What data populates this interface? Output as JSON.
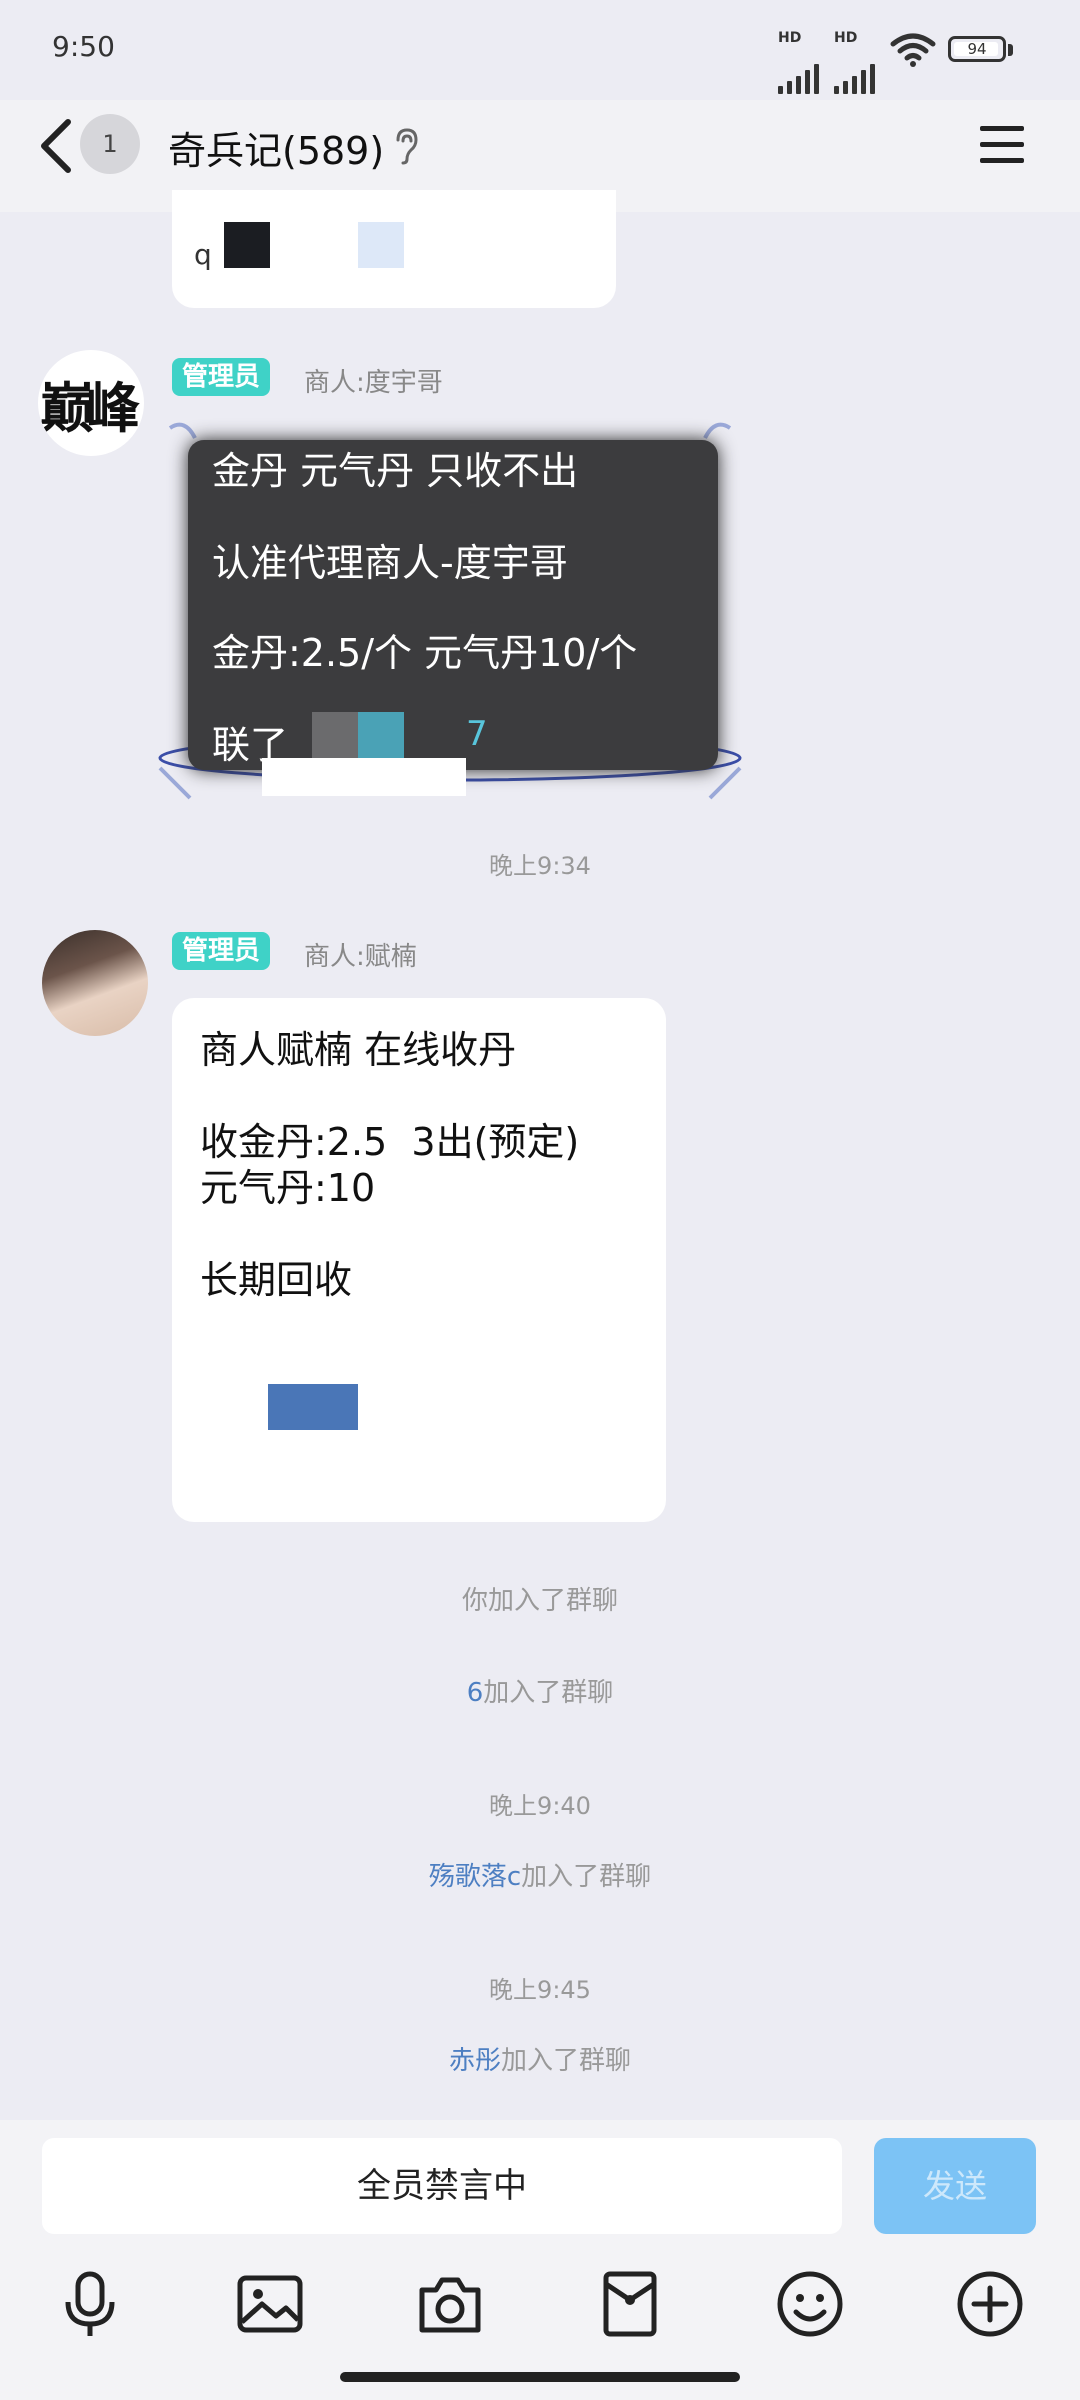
{
  "status_bar": {
    "time": "9:50",
    "signal_labels": [
      "HD",
      "HD"
    ],
    "battery": "94"
  },
  "header": {
    "unread_count": "1",
    "title": "奇兵记(589)"
  },
  "messages": {
    "partial_text": "q",
    "msg1": {
      "admin_tag": "管理员",
      "sender": "商人:度宇哥",
      "avatar_text": "巅峰",
      "lines": [
        "金丹 元气丹 只收不出",
        "认准代理商人-度宇哥",
        "金丹:2.5/个 元气丹10/个",
        "联了",
        "7"
      ]
    },
    "time1": "晚上9:34",
    "msg2": {
      "admin_tag": "管理员",
      "sender": "商人:赋楠",
      "lines": [
        "商人赋楠 在线收丹",
        "收金丹:2.5  3出(预定)",
        "元气丹:10",
        "长期回收"
      ]
    },
    "join1": "你加入了群聊",
    "join2": {
      "nick": "6",
      "text": "加入了群聊"
    },
    "time2": "晚上9:40",
    "join3": {
      "nick": "殇歌落c",
      "text": "加入了群聊"
    },
    "time3": "晚上9:45",
    "join4": {
      "nick": "赤彤",
      "text": "加入了群聊"
    }
  },
  "input": {
    "mute_text": "全员禁言中",
    "send_label": "发送"
  },
  "colors": {
    "admin_tag": "#3fd2c7",
    "nick": "#4d7fc2",
    "send_button": "#7cc3f5",
    "background": "#ececf3"
  },
  "icons": [
    "microphone-icon",
    "image-icon",
    "camera-icon",
    "red-packet-icon",
    "emoji-icon",
    "plus-icon"
  ]
}
